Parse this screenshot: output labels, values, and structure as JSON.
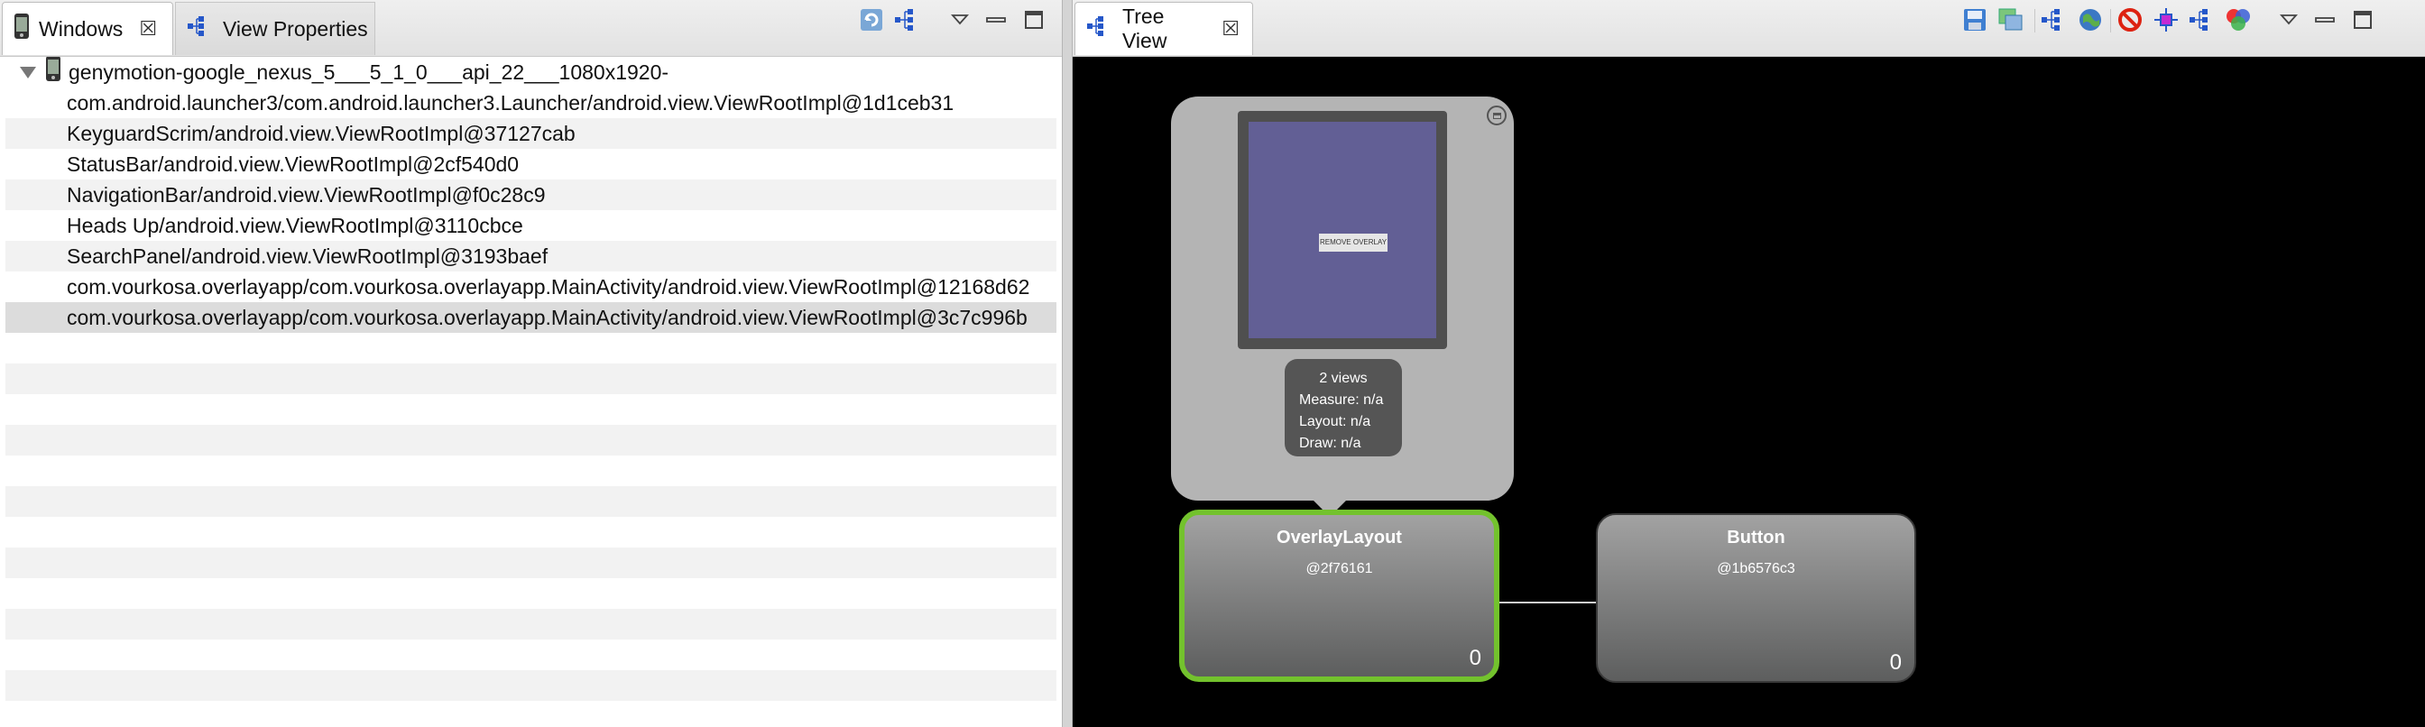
{
  "left_panel": {
    "tabs": [
      {
        "label": "Windows",
        "close": "☒"
      },
      {
        "label": "View Properties"
      }
    ],
    "toolbar": [
      "refresh-icon",
      "load-view-hierarchy-icon",
      "view-menu-icon",
      "minimize-icon",
      "maximize-icon"
    ],
    "device": "genymotion-google_nexus_5___5_1_0___api_22___1080x1920-",
    "windows": [
      "com.android.launcher3/com.android.launcher3.Launcher/android.view.ViewRootImpl@1d1ceb31",
      "KeyguardScrim/android.view.ViewRootImpl@37127cab",
      "StatusBar/android.view.ViewRootImpl@2cf540d0",
      "NavigationBar/android.view.ViewRootImpl@f0c28c9",
      "Heads Up/android.view.ViewRootImpl@3110cbce",
      "SearchPanel/android.view.ViewRootImpl@3193baef",
      "com.vourkosa.overlayapp/com.vourkosa.overlayapp.MainActivity/android.view.ViewRootImpl@12168d62",
      "com.vourkosa.overlayapp/com.vourkosa.overlayapp.MainActivity/android.view.ViewRootImpl@3c7c996b"
    ],
    "selected_index": 7
  },
  "right_panel": {
    "tab": {
      "label": "Tree View",
      "close": "☒"
    },
    "toolbar": [
      "save-icon",
      "layers-icon",
      "tree-icon",
      "globe-icon",
      "invalidate-icon",
      "request-layout-icon",
      "hierarchy-icon",
      "color-icon",
      "view-menu-icon",
      "minimize-icon",
      "maximize-icon"
    ],
    "preview": {
      "remove_button": "REMOVE OVERLAY",
      "stats": {
        "title": "2 views",
        "measure": "Measure: n/a",
        "layout": "Layout: n/a",
        "draw": "Draw: n/a"
      }
    },
    "nodes": [
      {
        "name": "OverlayLayout",
        "hash": "@2f76161",
        "count": "0",
        "selected": true
      },
      {
        "name": "Button",
        "hash": "@1b6576c3",
        "count": "0",
        "selected": false
      }
    ],
    "colors": {
      "selected_border": "#73c22d",
      "canvas": "#000000",
      "preview_screen": "#625f95"
    }
  }
}
